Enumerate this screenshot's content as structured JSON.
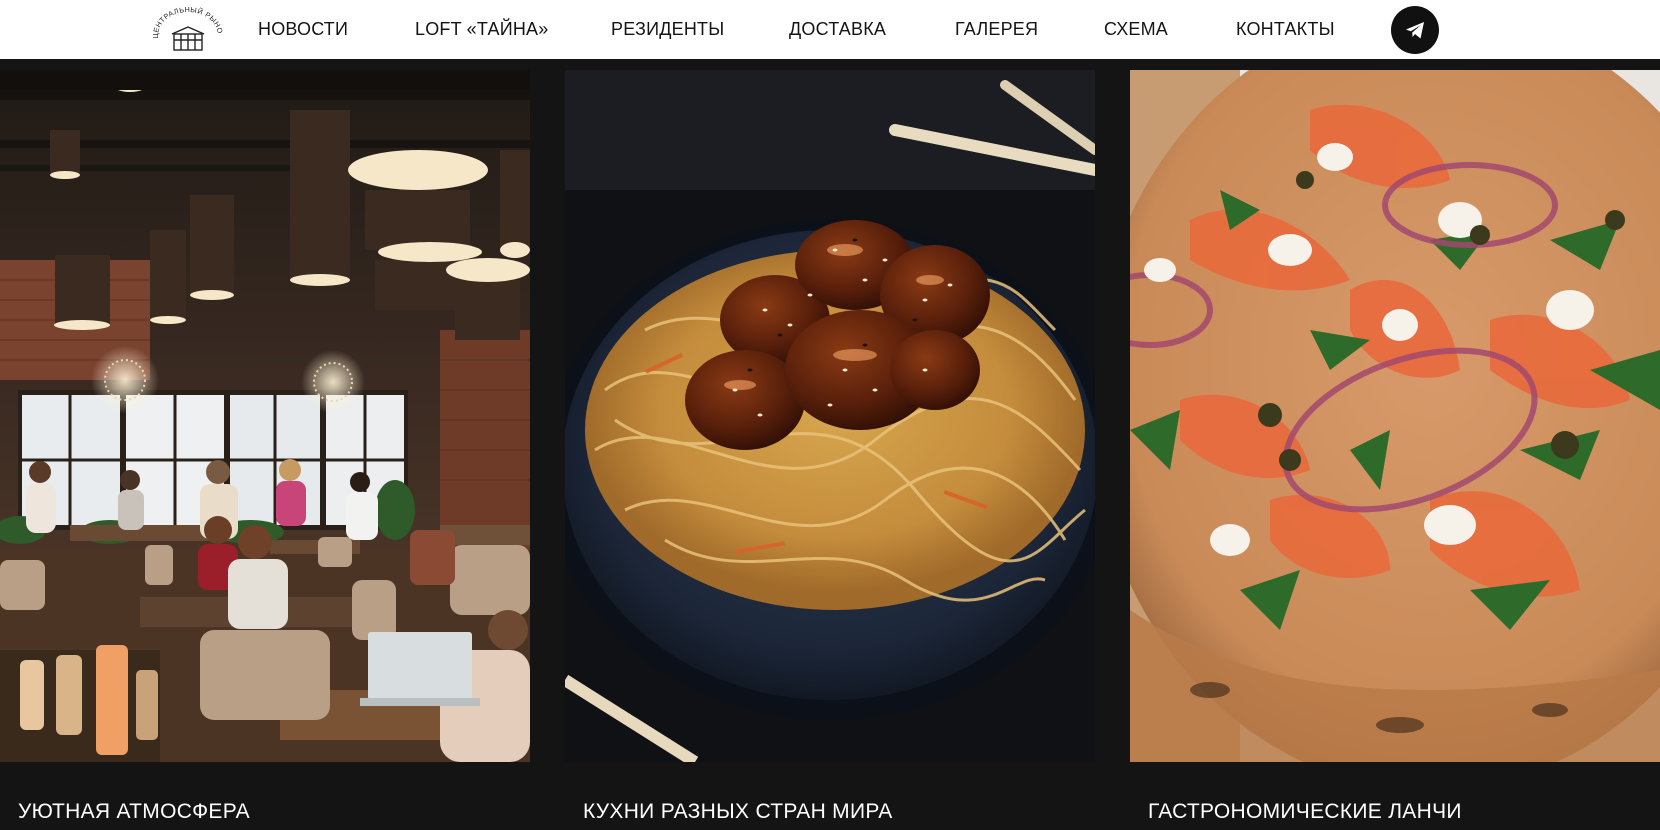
{
  "header": {
    "logo": {
      "text": "ЦЕНТРАЛЬНЫЙ РЫНОК",
      "icon": "market-building-icon"
    },
    "nav": [
      {
        "label": "НОВОСТИ"
      },
      {
        "label": "LOFT «ТАЙНА»"
      },
      {
        "label": "РЕЗИДЕНТЫ"
      },
      {
        "label": "ДОСТАВКА"
      },
      {
        "label": "ГАЛЕРЕЯ"
      },
      {
        "label": "СХЕМА"
      },
      {
        "label": "КОНТАКТЫ"
      }
    ],
    "telegram": {
      "icon": "telegram-icon"
    }
  },
  "gallery": [
    {
      "caption": "УЮТНАЯ АТМОСФЕРА",
      "image": "restaurant-interior-photo"
    },
    {
      "caption": "КУХНИ РАЗНЫХ СТРАН МИРА",
      "image": "noodles-with-glazed-meat-photo"
    },
    {
      "caption": "ГАСТРОНОМИЧЕСКИЕ ЛАНЧИ",
      "image": "salmon-pizza-photo"
    }
  ],
  "colors": {
    "background": "#141414",
    "header_background": "#ffffff",
    "text_dark": "#151515",
    "text_light": "#ffffff"
  }
}
